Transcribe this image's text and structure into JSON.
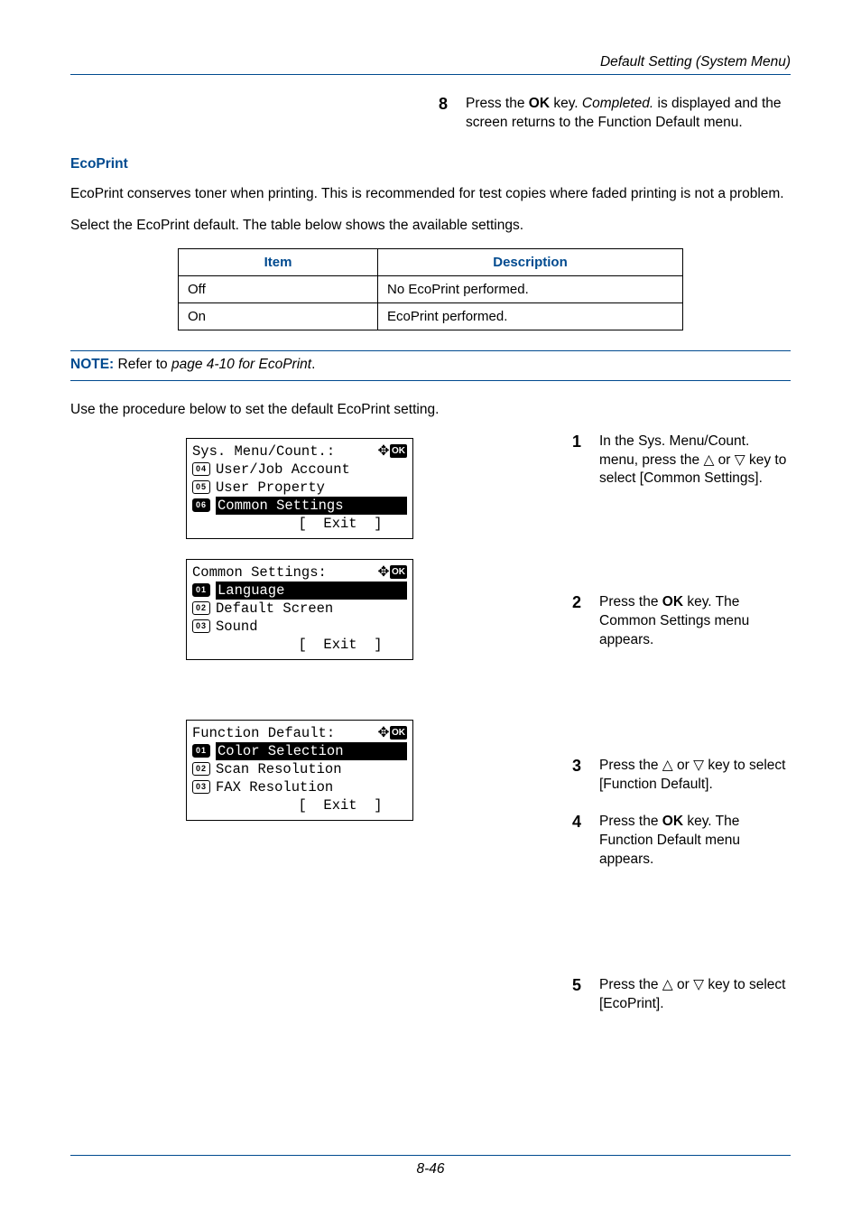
{
  "header_title": "Default Setting (System Menu)",
  "step8": {
    "num": "8",
    "text_a": "Press the ",
    "ok": "OK",
    "text_b": " key. ",
    "completed": "Completed.",
    "text_c": " is displayed and the screen returns to the Function Default menu."
  },
  "ecoprint_heading": "EcoPrint",
  "ecoprint_p1": "EcoPrint conserves toner when printing. This is recommended for test copies where faded printing is not a problem.",
  "ecoprint_p2": "Select the EcoPrint default. The table below shows the available settings.",
  "table": {
    "h1": "Item",
    "h2": "Description",
    "rows": [
      {
        "item": "Off",
        "desc": "No EcoPrint performed."
      },
      {
        "item": "On",
        "desc": "EcoPrint performed."
      }
    ]
  },
  "note": {
    "label": "NOTE:",
    "text_a": " Refer to ",
    "ref": "page 4-10 for EcoPrint",
    "text_b": "."
  },
  "proc_intro": "Use the procedure below to set the default EcoPrint setting.",
  "lcd1": {
    "title": "Sys. Menu/Count.:",
    "rows": [
      {
        "num": "04",
        "text": "User/Job Account"
      },
      {
        "num": "05",
        "text": "User Property"
      },
      {
        "num": "06",
        "text": "Common Settings",
        "hl": true
      }
    ],
    "exit": "[  Exit  ]"
  },
  "lcd2": {
    "title": "Common Settings:",
    "rows": [
      {
        "num": "01",
        "text": "Language",
        "hl": true
      },
      {
        "num": "02",
        "text": "Default Screen"
      },
      {
        "num": "03",
        "text": "Sound"
      }
    ],
    "exit": "[  Exit  ]"
  },
  "lcd3": {
    "title": "Function Default:",
    "rows": [
      {
        "num": "01",
        "text": "Color Selection",
        "hl": true
      },
      {
        "num": "02",
        "text": "Scan Resolution"
      },
      {
        "num": "03",
        "text": "FAX Resolution"
      }
    ],
    "exit": "[  Exit  ]"
  },
  "steps": {
    "s1": {
      "n": "1",
      "a": "In the Sys. Menu/Count. menu, press the ",
      "b": " or ",
      "c": " key to select [Common Settings]."
    },
    "s2": {
      "n": "2",
      "a": "Press the ",
      "ok": "OK",
      "b": " key. The Common Settings menu appears."
    },
    "s3": {
      "n": "3",
      "a": "Press the ",
      "b": " or ",
      "c": " key to select [Function Default]."
    },
    "s4": {
      "n": "4",
      "a": "Press the ",
      "ok": "OK",
      "b": " key. The Function Default menu appears."
    },
    "s5": {
      "n": "5",
      "a": "Press the ",
      "b": " or ",
      "c": " key to select [EcoPrint]."
    }
  },
  "icons": {
    "up": "△",
    "down": "▽",
    "nav": "✥",
    "ok": "OK"
  },
  "page_number": "8-46"
}
